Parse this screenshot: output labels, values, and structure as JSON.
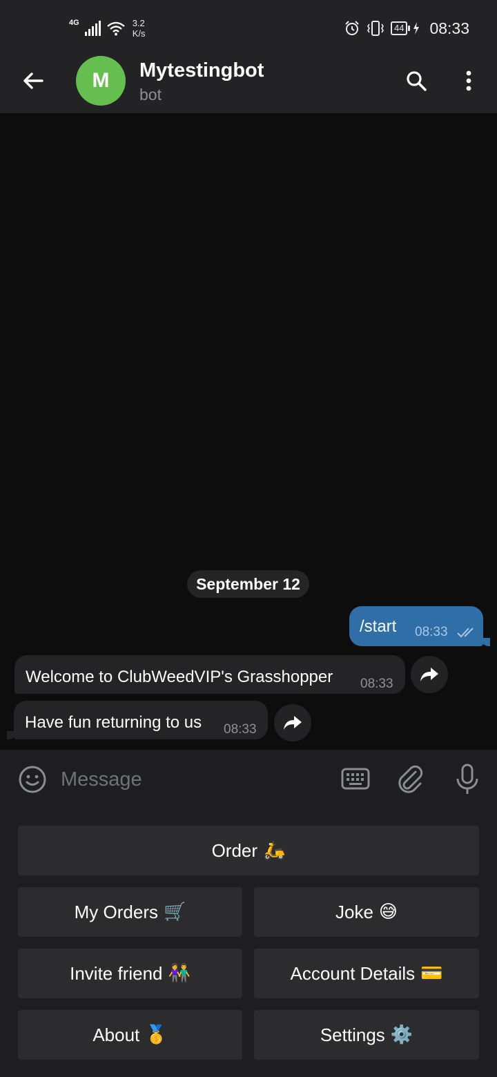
{
  "status_bar": {
    "network": "4G",
    "speed_value": "3.2",
    "speed_unit": "K/s",
    "battery": "44",
    "time": "08:33"
  },
  "header": {
    "avatar_letter": "M",
    "avatar_color": "#66bd50",
    "title": "Mytestingbot",
    "subtitle": "bot"
  },
  "chat": {
    "date_label": "September 12",
    "outgoing": {
      "text": "/start",
      "time": "08:33"
    },
    "incoming": [
      {
        "text": "Welcome to ClubWeedVIP's Grasshopper",
        "time": "08:33"
      },
      {
        "text": "Have fun returning to us",
        "time": "08:33"
      }
    ]
  },
  "composer": {
    "placeholder": "Message"
  },
  "bot_keyboard": {
    "order": {
      "label": "Order",
      "emoji": "🛵"
    },
    "my_orders": {
      "label": "My Orders",
      "emoji": "🛒"
    },
    "joke": {
      "label": "Joke",
      "emoji": "😅"
    },
    "invite_friend": {
      "label": "Invite friend",
      "emoji": "👫"
    },
    "account_details": {
      "label": "Account Details",
      "emoji": "💳"
    },
    "about": {
      "label": "About",
      "emoji": "🥇"
    },
    "settings": {
      "label": "Settings",
      "emoji": "⚙️"
    }
  },
  "colors": {
    "outgoing_bubble": "#2f6ea7",
    "incoming_bubble": "#242426",
    "header_bg": "#232325",
    "keyboard_button": "#2c2c2e"
  }
}
